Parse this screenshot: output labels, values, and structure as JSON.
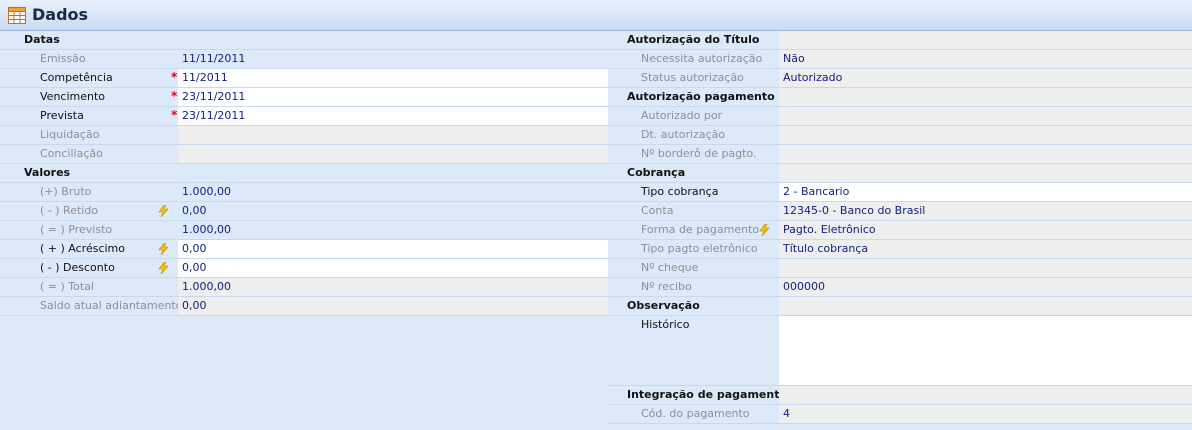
{
  "window": {
    "title": "Dados"
  },
  "left": {
    "datas": {
      "section": "Datas",
      "emissao": {
        "label": "Emissão",
        "value": "11/11/2011"
      },
      "competencia": {
        "label": "Competência",
        "value": "11/2011"
      },
      "vencimento": {
        "label": "Vencimento",
        "value": "23/11/2011"
      },
      "prevista": {
        "label": "Prevista",
        "value": "23/11/2011"
      },
      "liquidacao": {
        "label": "Liquidação",
        "value": ""
      },
      "conciliacao": {
        "label": "Conciliação",
        "value": ""
      }
    },
    "valores": {
      "section": "Valores",
      "bruto": {
        "label": "(+) Bruto",
        "value": "1.000,00"
      },
      "retido": {
        "label": "( - ) Retido",
        "value": "0,00"
      },
      "previsto": {
        "label": "( = ) Previsto",
        "value": "1.000,00"
      },
      "acrescimo": {
        "label": "( + ) Acréscimo",
        "value": "0,00"
      },
      "desconto": {
        "label": "( - ) Desconto",
        "value": "0,00"
      },
      "total": {
        "label": "( = ) Total",
        "value": "1.000,00"
      },
      "saldo": {
        "label": "Saldo atual adiantamento",
        "value": "0,00"
      }
    },
    "required_mark": "*"
  },
  "right": {
    "autorizacao_titulo": {
      "section": "Autorização do Título",
      "necessita": {
        "label": "Necessita autorização",
        "value": "Não"
      },
      "status": {
        "label": "Status autorização",
        "value": "Autorizado"
      }
    },
    "autorizacao_pagamento": {
      "section": "Autorização pagamento",
      "autorizado_por": {
        "label": "Autorizado por",
        "value": ""
      },
      "dt_autorizacao": {
        "label": "Dt. autorização",
        "value": ""
      },
      "bordero": {
        "label": "Nº borderô de pagto.",
        "value": ""
      }
    },
    "cobranca": {
      "section": "Cobrança",
      "tipo": {
        "label": "Tipo cobrança",
        "value": "2 - Bancario"
      },
      "conta": {
        "label": "Conta",
        "value": "12345-0 - Banco do Brasil"
      },
      "forma": {
        "label": "Forma de pagamento",
        "value": "Pagto. Eletrônico"
      },
      "tipo_eletronico": {
        "label": "Tipo pagto eletrônico",
        "value": "Título cobrança"
      },
      "cheque": {
        "label": "Nº cheque",
        "value": ""
      },
      "recibo": {
        "label": "Nº recibo",
        "value": "000000"
      }
    },
    "observacao": {
      "section": "Observação",
      "historico": {
        "label": "Histórico",
        "value": ""
      }
    },
    "integracao": {
      "section": "Integração de pagamento",
      "cod": {
        "label": "Cód. do pagamento",
        "value": "4"
      }
    }
  },
  "icons": {
    "title": "table-grid-icon",
    "action": "lightning-bolt-icon"
  },
  "colors": {
    "value_text": "#15217f",
    "required": "#e0001a",
    "panel": "#dce9f9",
    "bolt": "#f5c400"
  }
}
